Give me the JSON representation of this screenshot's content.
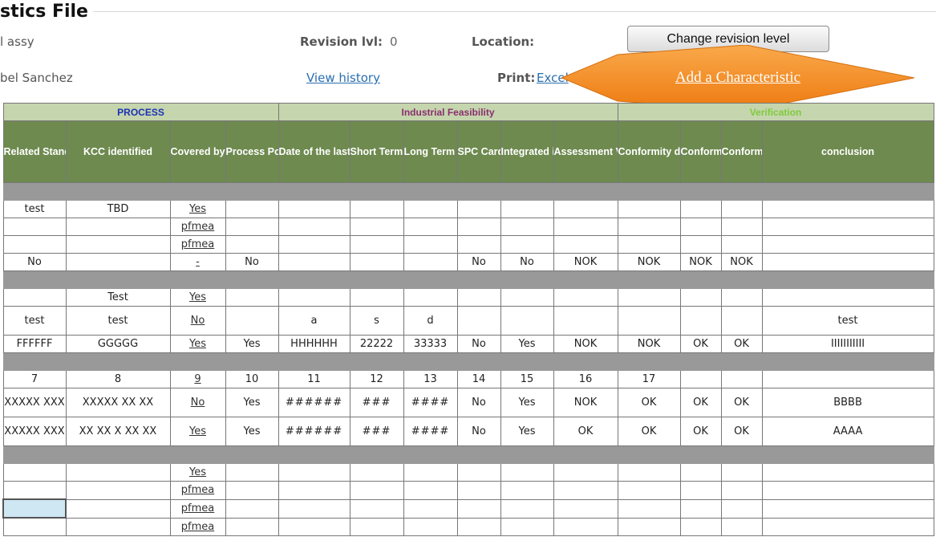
{
  "header": {
    "title": "stics File",
    "line1_left": "l assy",
    "line2_left": "bel Sanchez",
    "revision_label": "Revision lvl:",
    "revision_value": "0",
    "location_label": "Location:",
    "view_history": "View history",
    "print_label": "Print:",
    "print_link": "Excel",
    "change_revision_button": "Change revision level",
    "callout_text": "Add a Characteristic",
    "callout_color": "#f58a1f"
  },
  "groups": [
    "PROCESS",
    "Industrial Feasibility",
    "Verification"
  ],
  "columns": [
    "Related Standard",
    "KCC identified",
    "Covered by PFMEA ? (Y/N)",
    "Process Poka/ Yoke)",
    "Date of the last Capability",
    "Short Term Result",
    "Long Term Result",
    "SPC Card (Y/N)",
    "Integrated in Ctrl Plan",
    "Assessment Vs capability target",
    "Conformity drawing/ file",
    "Conformity Ctrl plan / file",
    "Conformity Ctrl Plan utilization",
    "conclusion"
  ],
  "rows": [
    {
      "type": "sep"
    },
    {
      "cells": [
        "test",
        "TBD",
        "Yes",
        "",
        "",
        "",
        "",
        "",
        "",
        "",
        "",
        "",
        "",
        ""
      ]
    },
    {
      "cells": [
        "",
        "",
        "pfmea",
        "",
        "",
        "",
        "",
        "",
        "",
        "",
        "",
        "",
        "",
        ""
      ]
    },
    {
      "cells": [
        "",
        "",
        "pfmea",
        "",
        "",
        "",
        "",
        "",
        "",
        "",
        "",
        "",
        "",
        ""
      ]
    },
    {
      "cells": [
        "No",
        "",
        "-",
        "No",
        "",
        "",
        "",
        "No",
        "No",
        "NOK",
        "NOK",
        "NOK",
        "NOK",
        ""
      ]
    },
    {
      "type": "sep"
    },
    {
      "cells": [
        "",
        "Test",
        "Yes",
        "",
        "",
        "",
        "",
        "",
        "",
        "",
        "",
        "",
        "",
        ""
      ]
    },
    {
      "cells": [
        "test",
        "test",
        "No",
        "",
        "a",
        "s",
        "d",
        "",
        "",
        "",
        "",
        "",
        "",
        "test"
      ],
      "height": "tall"
    },
    {
      "cells": [
        "FFFFFF",
        "GGGGG",
        "Yes",
        "Yes",
        "HHHHHH",
        "22222",
        "33333",
        "No",
        "Yes",
        "NOK",
        "NOK",
        "OK",
        "OK",
        "IIIIIIIIIII"
      ]
    },
    {
      "type": "sep"
    },
    {
      "cells": [
        "7",
        "8",
        "9",
        "10",
        "11",
        "12",
        "13",
        "14",
        "15",
        "16",
        "17",
        "",
        "",
        ""
      ]
    },
    {
      "cells": [
        "XXXXX XXX",
        "XXXXX XX XX",
        "No",
        "Yes",
        "######",
        "###",
        "####",
        "No",
        "Yes",
        "NOK",
        "OK",
        "OK",
        "OK",
        "BBBB"
      ],
      "height": "tall"
    },
    {
      "cells": [
        "XXXXX XXX",
        "XX XX X XX XX",
        "Yes",
        "Yes",
        "######",
        "###",
        "####",
        "No",
        "Yes",
        "OK",
        "OK",
        "OK",
        "OK",
        "AAAA"
      ],
      "height": "tall"
    },
    {
      "type": "sep"
    },
    {
      "cells": [
        "",
        "",
        "Yes",
        "",
        "",
        "",
        "",
        "",
        "",
        "",
        "",
        "",
        "",
        ""
      ]
    },
    {
      "cells": [
        "",
        "",
        "pfmea",
        "",
        "",
        "",
        "",
        "",
        "",
        "",
        "",
        "",
        "",
        ""
      ]
    },
    {
      "cells": [
        "",
        "",
        "pfmea",
        "",
        "",
        "",
        "",
        "",
        "",
        "",
        "",
        "",
        "",
        ""
      ],
      "selected_first": true
    },
    {
      "cells": [
        "",
        "",
        "pfmea",
        "",
        "",
        "",
        "",
        "",
        "",
        "",
        "",
        "",
        "",
        ""
      ]
    }
  ]
}
